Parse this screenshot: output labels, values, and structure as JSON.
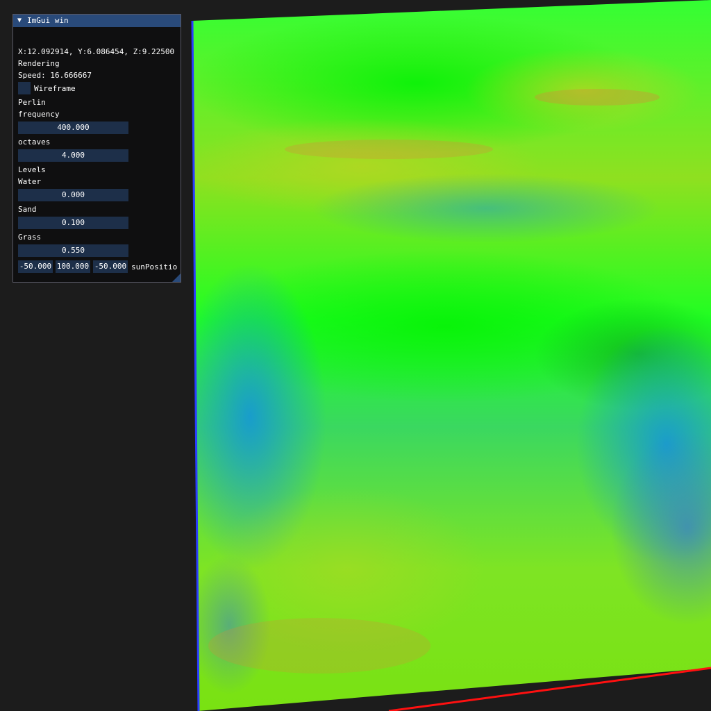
{
  "window": {
    "title": "ImGui win",
    "collapse_icon": "triangle-down-icon"
  },
  "stats": {
    "position": "X:12.092914, Y:6.086454, Z:9.22500",
    "rendering_label": "Rendering",
    "speed": "Speed: 16.666667"
  },
  "wireframe": {
    "label": "Wireframe",
    "checked": false
  },
  "perlin": {
    "section_label": "Perlin",
    "frequency_label": "frequency",
    "frequency_value": "400.000",
    "octaves_label": "octaves",
    "octaves_value": "4.000"
  },
  "levels": {
    "section_label": "Levels",
    "water_label": "Water",
    "water_value": "0.000",
    "sand_label": "Sand",
    "sand_value": "0.100",
    "grass_label": "Grass",
    "grass_value": "0.550"
  },
  "sun": {
    "x": "-50.000",
    "y": "100.000",
    "z": "-50.000",
    "label": "sunPositio"
  },
  "colors": {
    "background": "#1c1c1c",
    "panel": "#0f0f10",
    "title_bar": "#294a7a",
    "field": "#1d2f49",
    "terrain_green": "#22ff22",
    "terrain_yellow": "#9be020",
    "terrain_blue": "#1f9ad6",
    "edge_red": "#ff1010",
    "edge_blue": "#2a3cff"
  }
}
